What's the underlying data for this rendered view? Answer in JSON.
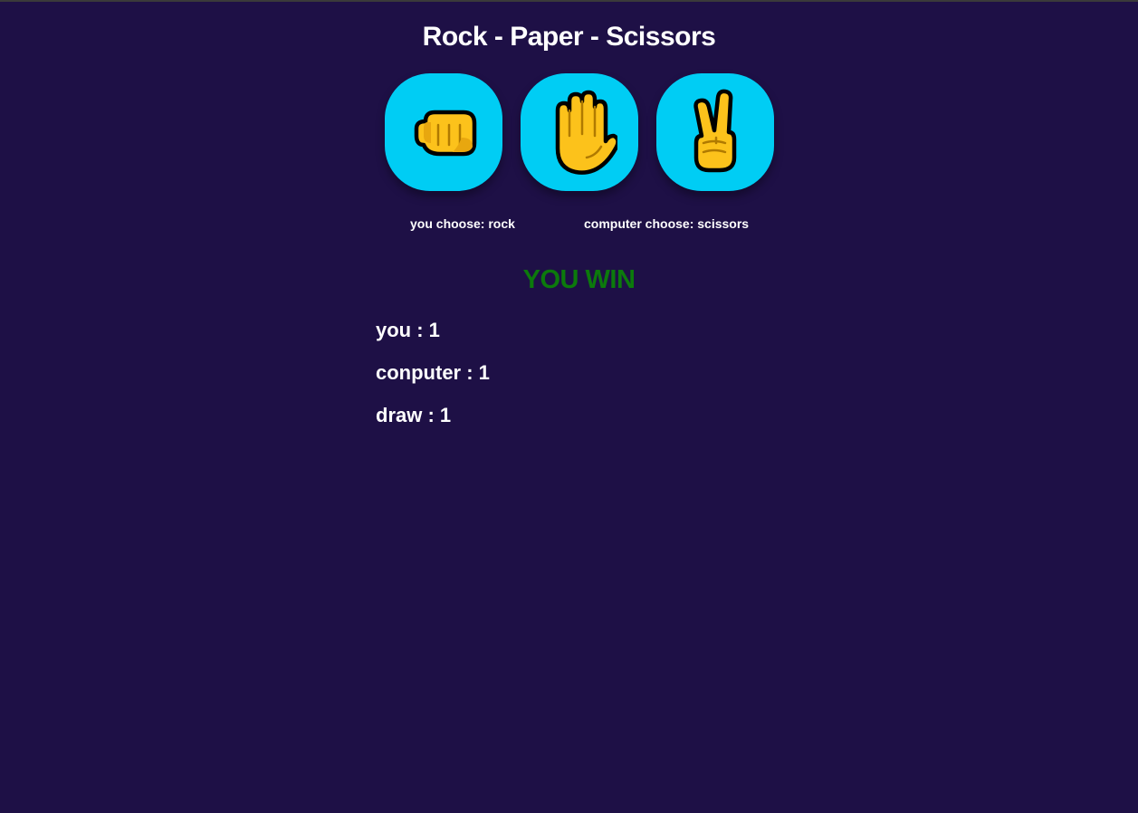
{
  "title": "Rock - Paper - Scissors",
  "choices": [
    {
      "name": "rock",
      "icon": "fist-icon"
    },
    {
      "name": "paper",
      "icon": "raised-hand-icon"
    },
    {
      "name": "scissors",
      "icon": "victory-hand-icon"
    }
  ],
  "picks": {
    "you": "you choose: rock",
    "computer": "computer choose: scissors"
  },
  "result": "YOU WIN",
  "scores": {
    "you": "you : 1",
    "computer": "conputer : 1",
    "draw": "draw : 1"
  },
  "colors": {
    "background": "#1e1046",
    "button": "#00cdf4",
    "win": "#0c7a0c",
    "emoji_fill": "#fcc21b"
  }
}
